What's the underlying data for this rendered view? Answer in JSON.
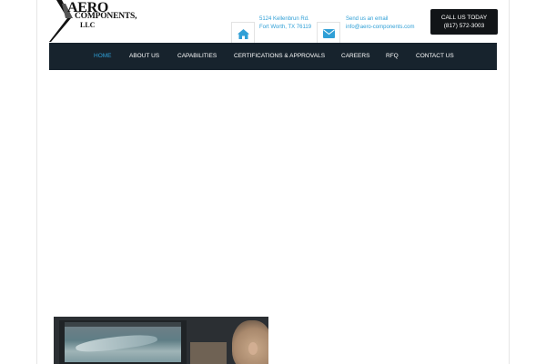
{
  "logo": {
    "line1": "AERO",
    "line2": "COMPONENTS,",
    "line3": "LLC"
  },
  "contact": {
    "address_line1": "5124 Kellenbrun Rd.",
    "address_line2": "Fort Worth, TX 76119",
    "email_label": "Send us an email",
    "email": "info@aero-components.com",
    "home_icon": "home-icon",
    "mail_icon": "envelope-icon"
  },
  "call": {
    "label": "CALL US TODAY",
    "phone": "(817) 572-3003"
  },
  "nav": {
    "items": [
      {
        "label": "HOME",
        "active": true
      },
      {
        "label": "ABOUT US"
      },
      {
        "label": "CAPABILITIES"
      },
      {
        "label": "CERTIFICATIONS & APPROVALS"
      },
      {
        "label": "CAREERS"
      },
      {
        "label": "RFQ"
      },
      {
        "label": "CONTACT US"
      }
    ]
  },
  "colors": {
    "nav_bg": "#17232d",
    "accent": "#2f9fd6",
    "button_bg": "#111417"
  }
}
